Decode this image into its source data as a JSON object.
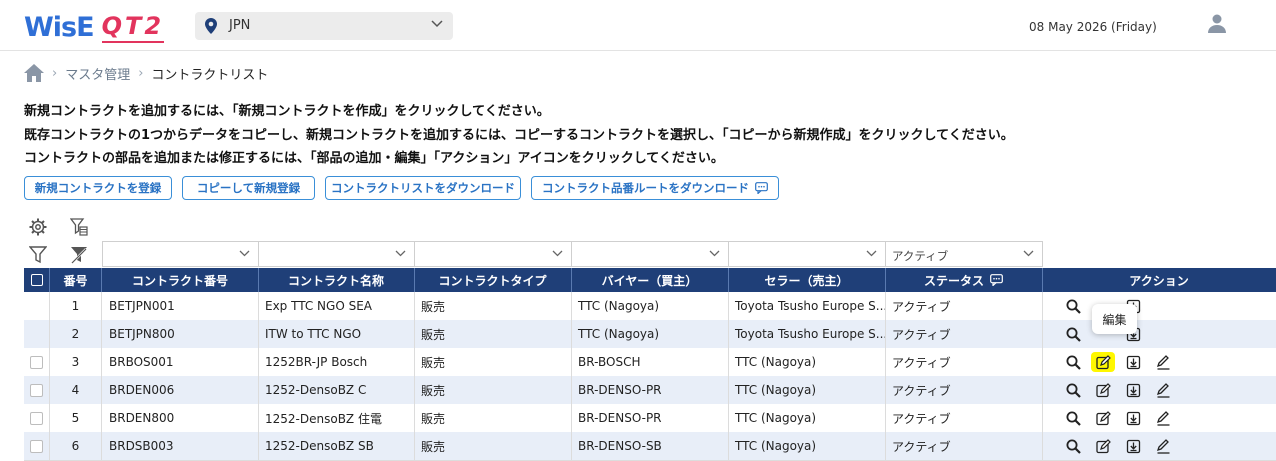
{
  "header": {
    "logo_wise": "WisE",
    "logo_qt": "QT2",
    "country": "JPN",
    "date": "08 May 2026 (Friday)"
  },
  "breadcrumb": {
    "level1": "マスタ管理",
    "current": "コントラクトリスト"
  },
  "instructions": [
    "新規コントラクトを追加するには、「新規コントラクトを作成」をクリックしてください。",
    "既存コントラクトの1つからデータをコピーし、新規コントラクトを追加するには、コピーするコントラクトを選択し、「コピーから新規作成」をクリックしてください。",
    "コントラクトの部品を追加または修正するには、「部品の追加・編集」「アクション」アイコンをクリックしてください。"
  ],
  "buttons": {
    "new": "新規コントラクトを登録",
    "copy": "コピーして新規登録",
    "download_list": "コントラクトリストをダウンロード",
    "download_route": "コントラクト品番ルートをダウンロード"
  },
  "filters": {
    "status_value": "アクティブ"
  },
  "table": {
    "headers": [
      "番号",
      "コントラクト番号",
      "コントラクト名称",
      "コントラクトタイプ",
      "バイヤー（買主）",
      "セラー（売主）",
      "ステータス",
      "アクション"
    ],
    "rows": [
      {
        "no": "1",
        "code": "BETJPN001",
        "name": "Exp TTC NGO SEA",
        "type": "販売",
        "buyer": "TTC (Nagoya)",
        "seller": "Toyota Tsusho Europe S...",
        "status": "アクティブ"
      },
      {
        "no": "2",
        "code": "BETJPN800",
        "name": "ITW to TTC NGO",
        "type": "販売",
        "buyer": "TTC (Nagoya)",
        "seller": "Toyota Tsusho Europe S...",
        "status": "アクティブ"
      },
      {
        "no": "3",
        "code": "BRBOS001",
        "name": "1252BR-JP Bosch",
        "type": "販売",
        "buyer": "BR-BOSCH",
        "seller": "TTC (Nagoya)",
        "status": "アクティブ"
      },
      {
        "no": "4",
        "code": "BRDEN006",
        "name": "1252-DensoBZ C",
        "type": "販売",
        "buyer": "BR-DENSO-PR",
        "seller": "TTC (Nagoya)",
        "status": "アクティブ"
      },
      {
        "no": "5",
        "code": "BRDEN800",
        "name": "1252-DensoBZ 住電",
        "type": "販売",
        "buyer": "BR-DENSO-PR",
        "seller": "TTC (Nagoya)",
        "status": "アクティブ"
      },
      {
        "no": "6",
        "code": "BRDSB003",
        "name": "1252-DensoBZ SB",
        "type": "販売",
        "buyer": "BR-DENSO-SB",
        "seller": "TTC (Nagoya)",
        "status": "アクティブ"
      }
    ]
  },
  "tooltip": "編集",
  "colors": {
    "header_bg": "#1f3f78",
    "accent": "#3a8fd8",
    "highlight": "#fff700",
    "row_alt": "#e8eef8"
  },
  "icons": [
    "pin-icon",
    "chevron-down-icon",
    "user-icon",
    "home-icon",
    "gear-icon",
    "column-filter-icon",
    "filter-icon",
    "clear-filter-icon",
    "comment-icon",
    "search-icon",
    "edit-icon",
    "download-icon",
    "pencil-icon"
  ]
}
